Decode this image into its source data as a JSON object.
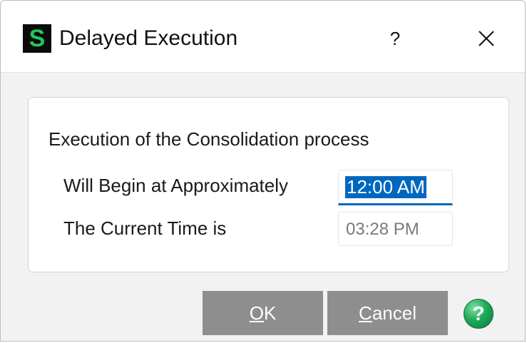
{
  "window": {
    "app_icon_glyph": "S",
    "title": "Delayed Execution",
    "help_glyph": "?",
    "close_icon": "close-icon"
  },
  "group": {
    "title": "Execution of the Consolidation process",
    "begin_label": "Will Begin at Approximately",
    "begin_value": "12:00 AM",
    "current_label": "The Current Time is",
    "current_value": "03:28 PM"
  },
  "buttons": {
    "ok_accel": "O",
    "ok_rest": "K",
    "cancel_accel": "C",
    "cancel_rest": "ancel",
    "help_glyph": "?"
  },
  "colors": {
    "accent": "#0067c0",
    "button_bg": "#8e8e8e",
    "app_icon_fg": "#22c55e",
    "help_icon": "#1faa5b"
  }
}
